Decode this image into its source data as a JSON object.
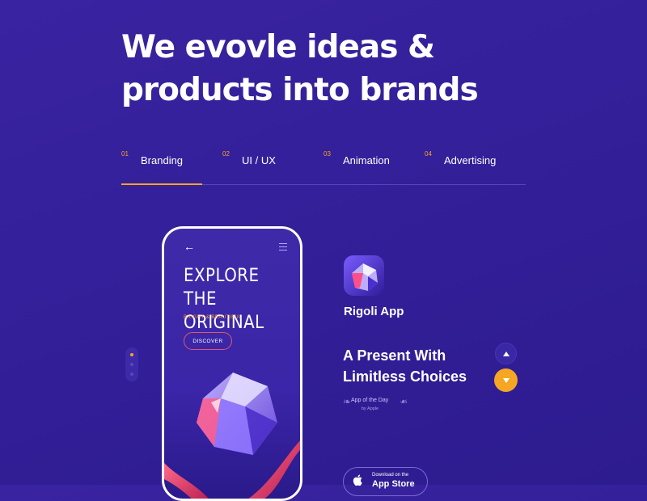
{
  "hero": {
    "title_line1": "We evovle ideas &",
    "title_line2": "products into brands"
  },
  "tabs": [
    {
      "num": "01",
      "label": "Branding",
      "active": true
    },
    {
      "num": "02",
      "label": "UI / UX",
      "active": false
    },
    {
      "num": "03",
      "label": "Animation",
      "active": false
    },
    {
      "num": "04",
      "label": "Advertising",
      "active": false
    }
  ],
  "phone": {
    "back_icon": "arrow-left-icon",
    "menu_icon": "hamburger-menu-icon",
    "title_line1": "EXPLORE",
    "title_line2": "THE ORIGINAL",
    "subtitle": "BRIGHT & BEAUTIFUL",
    "button": "DISCOVER"
  },
  "pager": {
    "count": 3,
    "active_index": 0
  },
  "app": {
    "name": "Rigoli App",
    "tagline_line1": "A Present With",
    "tagline_line2": "Limitless Choices",
    "award_line1": "App of the Day",
    "award_line2": "by Apple"
  },
  "store_button": {
    "line1": "Download on the",
    "line2": "App Store"
  },
  "colors": {
    "background": "#34209a",
    "accent": "#f5a623",
    "pink": "#e0566e"
  }
}
